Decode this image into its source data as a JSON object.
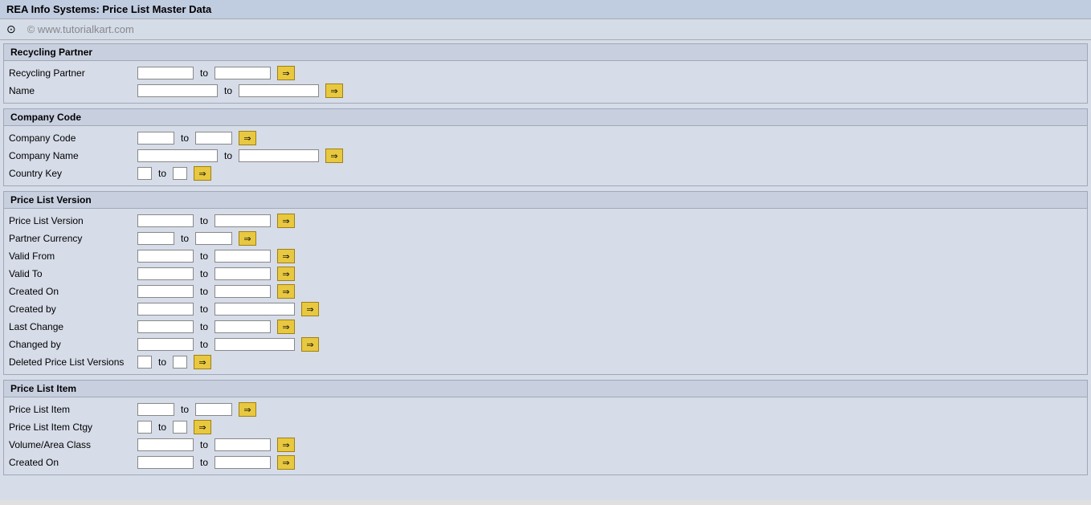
{
  "titleBar": {
    "title": "REA Info Systems: Price List Master Data"
  },
  "toolbar": {
    "icon": "⊙",
    "watermark": "© www.tutorialkart.com"
  },
  "sections": [
    {
      "id": "recycling-partner",
      "header": "Recycling Partner",
      "fields": [
        {
          "label": "Recycling Partner",
          "from_size": "md",
          "to_size": "md"
        },
        {
          "label": "Name",
          "from_size": "lg",
          "to_size": "lg"
        }
      ]
    },
    {
      "id": "company-code",
      "header": "Company Code",
      "fields": [
        {
          "label": "Company Code",
          "from_size": "sm",
          "to_size": "sm"
        },
        {
          "label": "Company Name",
          "from_size": "lg",
          "to_size": "lg"
        },
        {
          "label": "Country Key",
          "from_size": "xs",
          "to_size": "xs"
        }
      ]
    },
    {
      "id": "price-list-version",
      "header": "Price List Version",
      "fields": [
        {
          "label": "Price List Version",
          "from_size": "md",
          "to_size": "md"
        },
        {
          "label": "Partner Currency",
          "from_size": "sm",
          "to_size": "sm"
        },
        {
          "label": "Valid From",
          "from_size": "md",
          "to_size": "md"
        },
        {
          "label": "Valid To",
          "from_size": "md",
          "to_size": "md"
        },
        {
          "label": "Created On",
          "from_size": "md",
          "to_size": "md"
        },
        {
          "label": "Created by",
          "from_size": "md",
          "to_size": "lg"
        },
        {
          "label": "Last Change",
          "from_size": "md",
          "to_size": "md"
        },
        {
          "label": "Changed by",
          "from_size": "md",
          "to_size": "lg"
        },
        {
          "label": "Deleted Price List Versions",
          "from_size": "xs",
          "to_size": "xs"
        }
      ]
    },
    {
      "id": "price-list-item",
      "header": "Price List Item",
      "fields": [
        {
          "label": "Price List Item",
          "from_size": "sm",
          "to_size": "sm"
        },
        {
          "label": "Price List Item Ctgy",
          "from_size": "xs",
          "to_size": "xs"
        },
        {
          "label": "Volume/Area Class",
          "from_size": "md",
          "to_size": "md"
        },
        {
          "label": "Created On",
          "from_size": "md",
          "to_size": "md"
        }
      ]
    }
  ],
  "arrowLabel": "⇒",
  "toLabel": "to"
}
